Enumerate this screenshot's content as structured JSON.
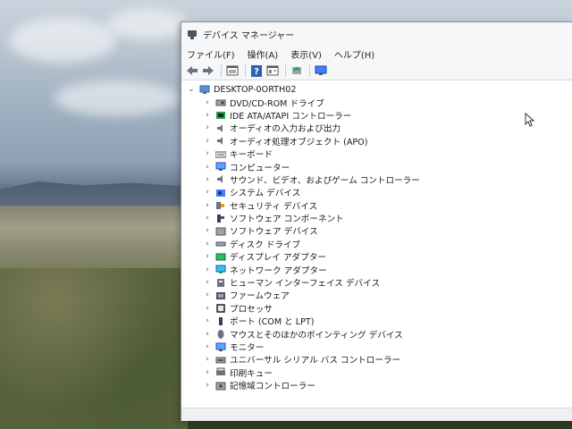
{
  "window": {
    "title": "デバイス マネージャー"
  },
  "menu": [
    {
      "label": "ファイル(F)"
    },
    {
      "label": "操作(A)"
    },
    {
      "label": "表示(V)"
    },
    {
      "label": "ヘルプ(H)"
    }
  ],
  "toolbar": {
    "buttons": [
      "back-arrow-icon",
      "forward-arrow-icon",
      "properties-sheet-icon",
      "help-icon",
      "console-tree-icon",
      "update-driver-icon",
      "scan-hardware-monitor-icon"
    ]
  },
  "tree": {
    "root": {
      "label": "DESKTOP-0ORTH02",
      "icon": "computer-icon"
    },
    "children": [
      {
        "label": "DVD/CD-ROM ドライブ",
        "icon": "dvd-drive-icon"
      },
      {
        "label": "IDE ATA/ATAPI コントローラー",
        "icon": "ide-controller-icon"
      },
      {
        "label": "オーディオの入力および出力",
        "icon": "speaker-icon"
      },
      {
        "label": "オーディオ処理オブジェクト (APO)",
        "icon": "speaker-icon"
      },
      {
        "label": "キーボード",
        "icon": "keyboard-icon"
      },
      {
        "label": "コンピューター",
        "icon": "monitor-icon"
      },
      {
        "label": "サウンド、ビデオ、およびゲーム コントローラー",
        "icon": "speaker-icon"
      },
      {
        "label": "システム デバイス",
        "icon": "system-device-icon"
      },
      {
        "label": "セキュリティ デバイス",
        "icon": "security-key-icon"
      },
      {
        "label": "ソフトウェア コンポーネント",
        "icon": "software-component-icon"
      },
      {
        "label": "ソフトウェア デバイス",
        "icon": "software-device-icon"
      },
      {
        "label": "ディスク ドライブ",
        "icon": "disk-drive-icon"
      },
      {
        "label": "ディスプレイ アダプター",
        "icon": "display-adapter-icon"
      },
      {
        "label": "ネットワーク アダプター",
        "icon": "network-adapter-icon"
      },
      {
        "label": "ヒューマン インターフェイス デバイス",
        "icon": "hid-icon"
      },
      {
        "label": "ファームウェア",
        "icon": "firmware-icon"
      },
      {
        "label": "プロセッサ",
        "icon": "processor-icon"
      },
      {
        "label": "ポート (COM と LPT)",
        "icon": "port-icon"
      },
      {
        "label": "マウスとそのほかのポインティング デバイス",
        "icon": "mouse-icon"
      },
      {
        "label": "モニター",
        "icon": "monitor-icon"
      },
      {
        "label": "ユニバーサル シリアル バス コントローラー",
        "icon": "usb-icon"
      },
      {
        "label": "印刷キュー",
        "icon": "printer-icon"
      },
      {
        "label": "記憶域コントローラー",
        "icon": "storage-controller-icon"
      }
    ]
  },
  "colors": {
    "accent": "#2f7bd6",
    "text": "#1a1a1a"
  }
}
